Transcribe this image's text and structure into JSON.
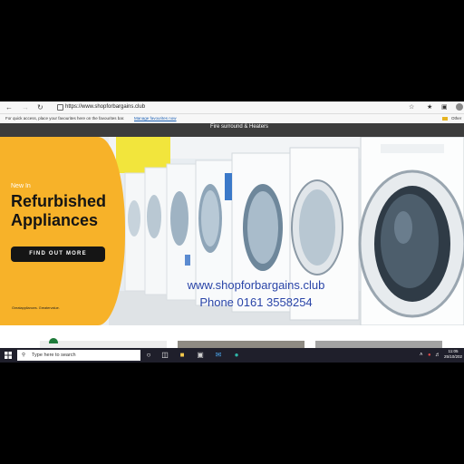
{
  "browser": {
    "url": "https://www.shopforbargains.club",
    "favourites_message": "For quick access, place your favourites here on the favourites bar.",
    "favourites_link": "Manage favourites now",
    "other_favourites": "Other"
  },
  "site_nav": {
    "item": "Fire surround & Heaters"
  },
  "hero": {
    "eyebrow": "New In",
    "headline_line1": "Refurbished",
    "headline_line2": "Appliances",
    "cta": "FIND OUT MORE",
    "tagline": "Greatappliances. Greatervalue."
  },
  "overlay": {
    "website": "www.shopforbargains.club",
    "phone": "Phone 0161 3558254"
  },
  "taskbar": {
    "search_placeholder": "Type here to search",
    "time": "11:05",
    "date": "25/10/202"
  },
  "colors": {
    "promo": "#f7b229",
    "overlay_text": "#2a45a8",
    "taskbar": "#1f1f2b"
  }
}
